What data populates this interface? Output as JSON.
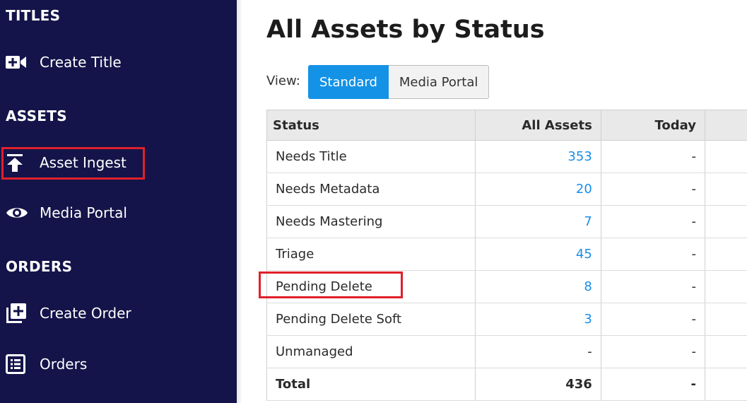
{
  "sidebar": {
    "sections": [
      {
        "title": "TITLES"
      },
      {
        "title": "ASSETS"
      },
      {
        "title": "ORDERS"
      }
    ],
    "items": [
      {
        "label": "Create Title",
        "icon": "video-plus-icon"
      },
      {
        "label": "Asset Ingest",
        "icon": "upload-icon"
      },
      {
        "label": "Media Portal",
        "icon": "eye-icon"
      },
      {
        "label": "Create Order",
        "icon": "add-box-icon"
      },
      {
        "label": "Orders",
        "icon": "list-icon"
      }
    ]
  },
  "main": {
    "title": "All Assets by Status",
    "view_label": "View:",
    "view_buttons": [
      "Standard",
      "Media Portal"
    ],
    "active_view": "Standard",
    "table": {
      "headers": [
        "Status",
        "All Assets",
        "Today"
      ],
      "rows": [
        {
          "status": "Needs Title",
          "all": "353",
          "today": "-"
        },
        {
          "status": "Needs Metadata",
          "all": "20",
          "today": "-"
        },
        {
          "status": "Needs Mastering",
          "all": "7",
          "today": "-"
        },
        {
          "status": "Triage",
          "all": "45",
          "today": "-"
        },
        {
          "status": "Pending Delete",
          "all": "8",
          "today": "-"
        },
        {
          "status": "Pending Delete Soft",
          "all": "3",
          "today": "-"
        },
        {
          "status": "Unmanaged",
          "all": "-",
          "today": "-"
        }
      ],
      "total": {
        "label": "Total",
        "all": "436",
        "today": "-"
      }
    }
  },
  "colors": {
    "sidebar_bg": "#14144a",
    "accent_blue": "#1492e6",
    "highlight_red": "#e0202a"
  }
}
